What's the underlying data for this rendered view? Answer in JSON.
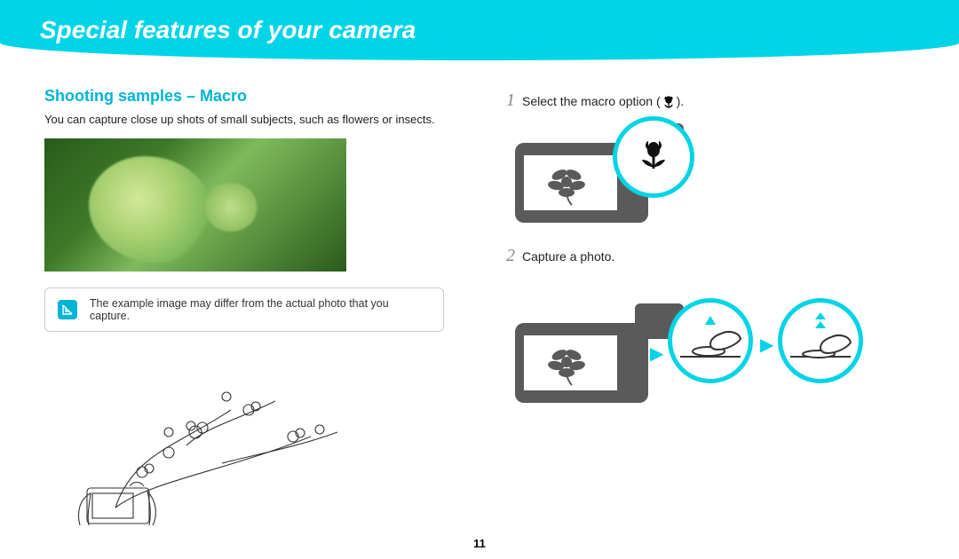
{
  "header": {
    "title": "Special features of your camera"
  },
  "left": {
    "heading": "Shooting samples – Macro",
    "intro": "You can capture close up shots of small subjects, such as flowers or insects.",
    "note_text": "The example image may differ from the actual photo that you capture."
  },
  "steps": {
    "s1_num": "1",
    "s1_prefix": "Select the macro option (",
    "s1_suffix": ").",
    "s2_num": "2",
    "s2_text": "Capture a photo."
  },
  "page_number": "11",
  "icons": {
    "note": "note-icon",
    "macro": "tulip-icon",
    "camera": "camera-icon",
    "shutter_half": "shutter-half-press-icon",
    "shutter_full": "shutter-full-press-icon"
  }
}
